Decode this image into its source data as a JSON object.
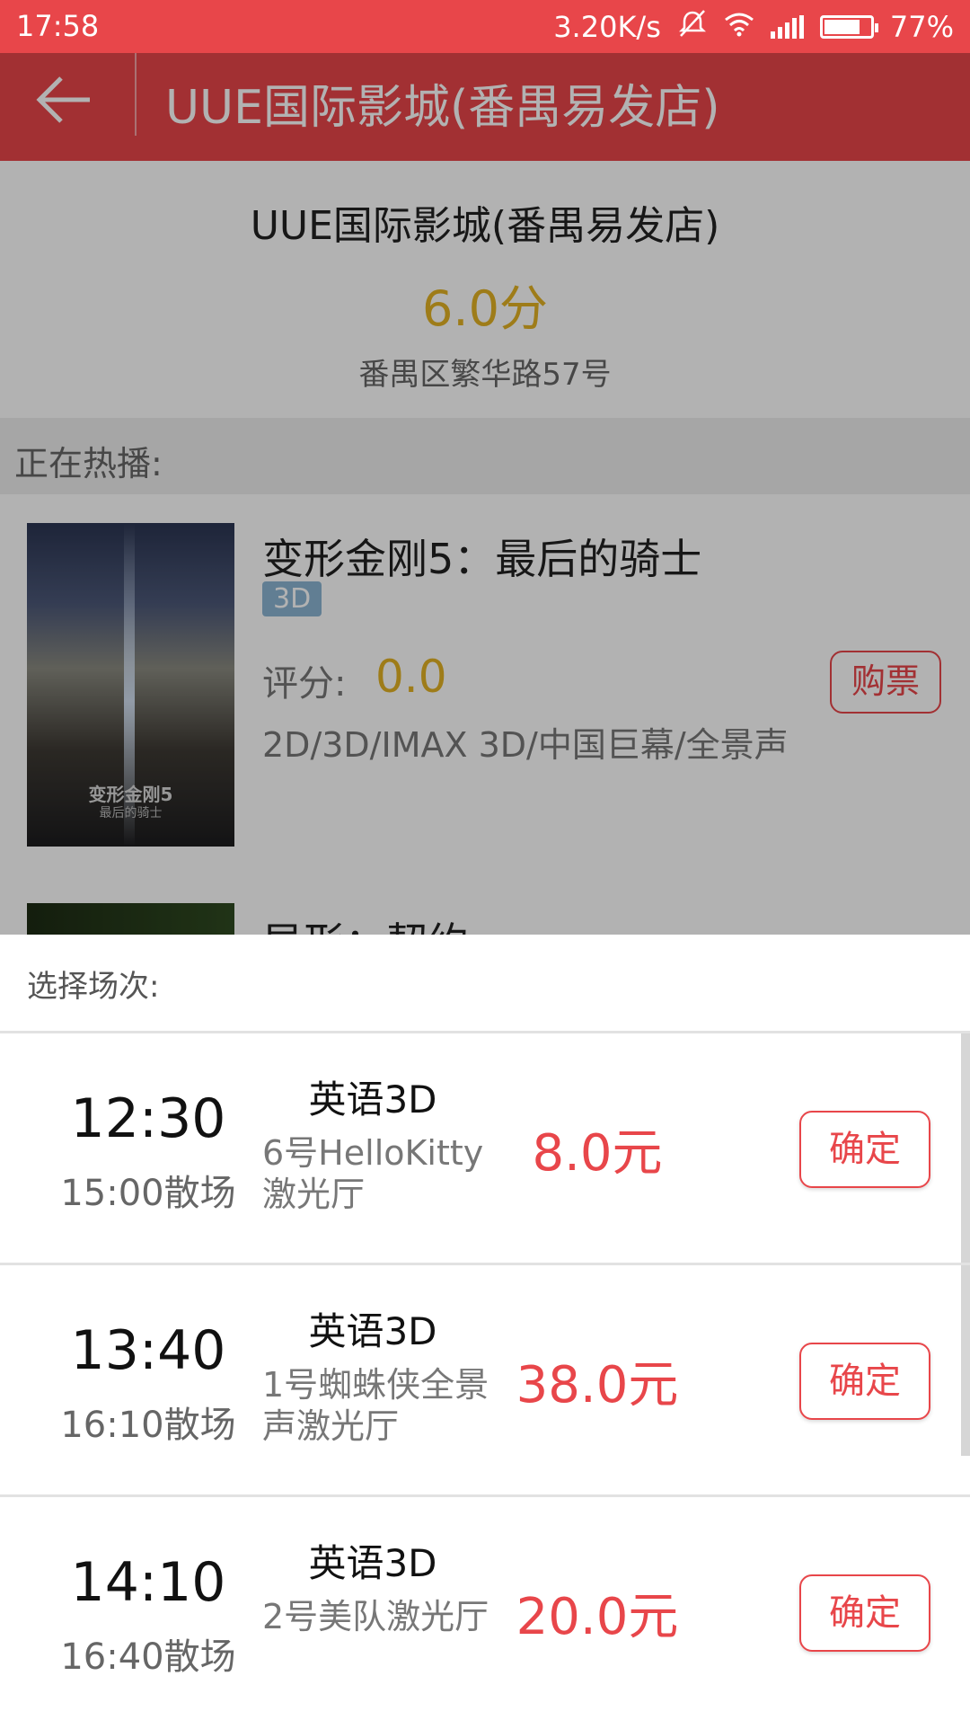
{
  "status_bar": {
    "time": "17:58",
    "speed": "3.20K/s",
    "battery": "77%"
  },
  "toolbar": {
    "title": "UUE国际影城(番禺易发店)"
  },
  "cinema": {
    "name": "UUE国际影城(番禺易发店)",
    "score": "6.0分",
    "address": "番禺区繁华路57号"
  },
  "now_playing": {
    "label": "正在热播:"
  },
  "movies": [
    {
      "title": "变形金刚5：最后的骑士",
      "badge": "3D",
      "rating_label": "评分:",
      "rating_value": "0.0",
      "formats": "2D/3D/IMAX 3D/中国巨幕/全景声",
      "buy_label": "购票",
      "poster_title": "变形金刚5",
      "poster_subtitle": "最后的骑士"
    },
    {
      "title": "异形：契约"
    }
  ],
  "showtimes": {
    "header": "选择场次:",
    "items": [
      {
        "start": "12:30",
        "end": "15:00散场",
        "language": "英语3D",
        "hall": "6号HelloKitty激光厅",
        "price": "8.0元",
        "confirm": "确定"
      },
      {
        "start": "13:40",
        "end": "16:10散场",
        "language": "英语3D",
        "hall": "1号蜘蛛侠全景声激光厅",
        "price": "38.0元",
        "confirm": "确定"
      },
      {
        "start": "14:10",
        "end": "16:40散场",
        "language": "英语3D",
        "hall": "2号美队激光厅",
        "price": "20.0元",
        "confirm": "确定"
      }
    ]
  },
  "colors": {
    "accent": "#e8464a",
    "score": "#e2b224"
  }
}
